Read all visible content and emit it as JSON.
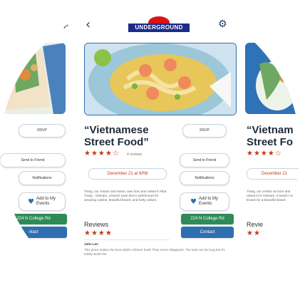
{
  "topbar": {
    "logo_text": "UNDERGROUND"
  },
  "cards": [
    {
      "title_line1": "“Vietnamese",
      "title_line2": "Street Food”",
      "stars": "★★★★☆",
      "reviews_label": "4 reviews",
      "date": "December 21 at 6PM",
      "description": "Trang, our creator and owner, was born and raised in Nha Trang - Vietnam, a beach town that is well-known for amazing cuisine, beautiful beach, and lively culture.",
      "reviews_heading": "Reviews",
      "review_stars": "★★★★",
      "reviewer": "John Lee",
      "review_text": "This place makes the best adobo chicken bowl! They never disappoint. The wait can be long but it's totally worth the",
      "buttons": {
        "rsvp": "RSVP",
        "send_to_friend": "Send to Friend",
        "notifications": "Notifications",
        "add_to_events": "Add to My Events",
        "address": "224 N College Rd",
        "contact": "Contact"
      }
    }
  ],
  "right_peek": {
    "title_line1": "“Vietnam",
    "title_line2": "Street Fo",
    "date": "December 21",
    "reviews_heading": "Revie",
    "desc": "Trang, our creator an born and raised in N Vietnam, a beach t well-known for a beautiful beach"
  },
  "left_peek": {
    "address": "224 N College Rd",
    "contact": "ntact"
  },
  "colors": {
    "accent_blue": "#2f6fb0",
    "accent_green": "#2e8b57",
    "star_red": "#c43a1a"
  }
}
